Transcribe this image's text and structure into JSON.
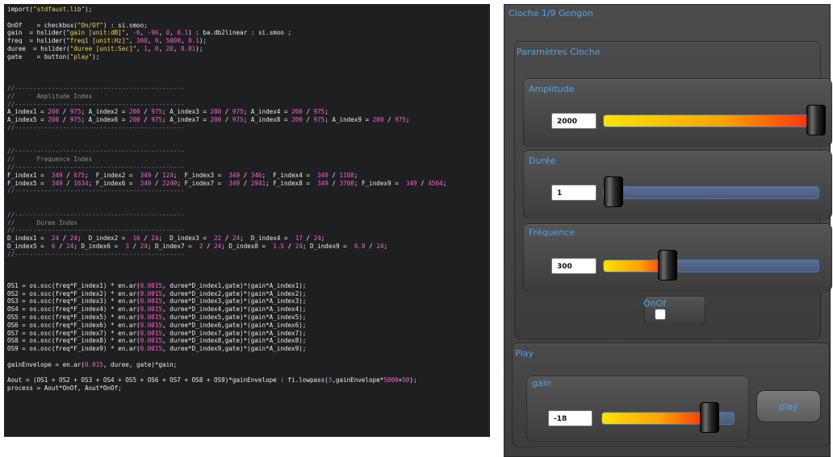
{
  "code": {
    "lines": [
      [
        [
          "import(",
          "txt"
        ],
        [
          "\"stdfaust.lib\"",
          "str"
        ],
        [
          ");",
          "txt"
        ]
      ],
      [],
      [
        [
          "OnOf    = checkbox(",
          "txt"
        ],
        [
          "\"On/Of\"",
          "str"
        ],
        [
          ") : si.smoo;",
          "txt"
        ]
      ],
      [
        [
          "gain  = hslider(",
          "txt"
        ],
        [
          "\"gain [unit:dB]\"",
          "str"
        ],
        [
          ", ",
          "txt"
        ],
        [
          "-6",
          "num"
        ],
        [
          ", ",
          "txt"
        ],
        [
          "-96",
          "num"
        ],
        [
          ", ",
          "txt"
        ],
        [
          "0",
          "num"
        ],
        [
          ", ",
          "txt"
        ],
        [
          "0.1",
          "num"
        ],
        [
          ") : ba.db2linear : si.smoo ;",
          "txt"
        ]
      ],
      [
        [
          "freq  = hslider(",
          "txt"
        ],
        [
          "\"freq1 [unit:Hz]\"",
          "str"
        ],
        [
          ", ",
          "txt"
        ],
        [
          "300",
          "num"
        ],
        [
          ", ",
          "txt"
        ],
        [
          "0",
          "num"
        ],
        [
          ", ",
          "txt"
        ],
        [
          "5000",
          "num"
        ],
        [
          ", ",
          "txt"
        ],
        [
          "0.1",
          "num"
        ],
        [
          ");",
          "txt"
        ]
      ],
      [
        [
          "duree  = hslider(",
          "txt"
        ],
        [
          "\"duree [unit:Sec]\"",
          "str"
        ],
        [
          ", ",
          "txt"
        ],
        [
          "1",
          "num"
        ],
        [
          ", ",
          "txt"
        ],
        [
          "0",
          "num"
        ],
        [
          ", ",
          "txt"
        ],
        [
          "20",
          "num"
        ],
        [
          ", ",
          "txt"
        ],
        [
          "0.01",
          "num"
        ],
        [
          ");",
          "txt"
        ]
      ],
      [
        [
          "gate    = button(",
          "txt"
        ],
        [
          "\"play\"",
          "str"
        ],
        [
          ");",
          "txt"
        ]
      ],
      [],
      [],
      [],
      [
        [
          "//----------------------------------------------",
          "cmt"
        ]
      ],
      [
        [
          "//      Amplitude Index",
          "cmt"
        ]
      ],
      [
        [
          "//----------------------------------------------",
          "cmt"
        ]
      ],
      [
        [
          "A_index1 = ",
          "txt"
        ],
        [
          "200",
          "num"
        ],
        [
          " / ",
          "txt"
        ],
        [
          "975",
          "num"
        ],
        [
          "; A_index2 = ",
          "txt"
        ],
        [
          "200",
          "num"
        ],
        [
          " / ",
          "txt"
        ],
        [
          "975",
          "num"
        ],
        [
          "; A_index3 = ",
          "txt"
        ],
        [
          "200",
          "num"
        ],
        [
          " / ",
          "txt"
        ],
        [
          "975",
          "num"
        ],
        [
          "; A_index4 = ",
          "txt"
        ],
        [
          "200",
          "num"
        ],
        [
          " / ",
          "txt"
        ],
        [
          "975",
          "num"
        ],
        [
          ";",
          "txt"
        ]
      ],
      [
        [
          "A_index5 = ",
          "txt"
        ],
        [
          "200",
          "num"
        ],
        [
          " / ",
          "txt"
        ],
        [
          "975",
          "num"
        ],
        [
          "; A_index6 = ",
          "txt"
        ],
        [
          "200",
          "num"
        ],
        [
          " / ",
          "txt"
        ],
        [
          "975",
          "num"
        ],
        [
          "; A_index7 = ",
          "txt"
        ],
        [
          "200",
          "num"
        ],
        [
          " / ",
          "txt"
        ],
        [
          "975",
          "num"
        ],
        [
          "; A_index8 = ",
          "txt"
        ],
        [
          "200",
          "num"
        ],
        [
          " / ",
          "txt"
        ],
        [
          "975",
          "num"
        ],
        [
          "; A_index9 = ",
          "txt"
        ],
        [
          "200",
          "num"
        ],
        [
          " / ",
          "txt"
        ],
        [
          "975",
          "num"
        ],
        [
          ";",
          "txt"
        ]
      ],
      [
        [
          "//----------------------------------------------",
          "cmt"
        ]
      ],
      [],
      [],
      [
        [
          "//----------------------------------------------",
          "cmt"
        ]
      ],
      [
        [
          "//      Frequence Index",
          "cmt"
        ]
      ],
      [
        [
          "//----------------------------------------------",
          "cmt"
        ]
      ],
      [
        [
          "F_index1 =  ",
          "txt"
        ],
        [
          "349",
          "num"
        ],
        [
          " / ",
          "txt"
        ],
        [
          "675",
          "num"
        ],
        [
          ";  F_index2 =  ",
          "txt"
        ],
        [
          "349",
          "num"
        ],
        [
          " / ",
          "txt"
        ],
        [
          "124",
          "num"
        ],
        [
          ";  F_index3 =  ",
          "txt"
        ],
        [
          "349",
          "num"
        ],
        [
          " / ",
          "txt"
        ],
        [
          "346",
          "num"
        ],
        [
          ";  F_index4 =  ",
          "txt"
        ],
        [
          "349",
          "num"
        ],
        [
          " / ",
          "txt"
        ],
        [
          "1108",
          "num"
        ],
        [
          ";",
          "txt"
        ]
      ],
      [
        [
          "F_index5 =  ",
          "txt"
        ],
        [
          "349",
          "num"
        ],
        [
          " / ",
          "txt"
        ],
        [
          "1634",
          "num"
        ],
        [
          "; F_index6 =  ",
          "txt"
        ],
        [
          "349",
          "num"
        ],
        [
          " / ",
          "txt"
        ],
        [
          "2249",
          "num"
        ],
        [
          "; F_index7 =  ",
          "txt"
        ],
        [
          "349",
          "num"
        ],
        [
          " / ",
          "txt"
        ],
        [
          "2941",
          "num"
        ],
        [
          "; F_index8 =  ",
          "txt"
        ],
        [
          "349",
          "num"
        ],
        [
          " / ",
          "txt"
        ],
        [
          "3700",
          "num"
        ],
        [
          "; F_index9 =  ",
          "txt"
        ],
        [
          "349",
          "num"
        ],
        [
          " / ",
          "txt"
        ],
        [
          "4504",
          "num"
        ],
        [
          ";",
          "txt"
        ]
      ],
      [
        [
          "//----------------------------------------------",
          "cmt"
        ]
      ],
      [],
      [],
      [
        [
          "//----------------------------------------------",
          "cmt"
        ]
      ],
      [
        [
          "//      Duree Index",
          "cmt"
        ]
      ],
      [
        [
          "//----------------------------------------------",
          "cmt"
        ]
      ],
      [
        [
          "D_index1 =  ",
          "txt"
        ],
        [
          "24",
          "num"
        ],
        [
          " / ",
          "txt"
        ],
        [
          "24",
          "num"
        ],
        [
          ";  D_index2 =  ",
          "txt"
        ],
        [
          "16",
          "num"
        ],
        [
          " / ",
          "txt"
        ],
        [
          "24",
          "num"
        ],
        [
          ";  D_index3 =  ",
          "txt"
        ],
        [
          "22",
          "num"
        ],
        [
          " / ",
          "txt"
        ],
        [
          "24",
          "num"
        ],
        [
          ";  D_index4 =  ",
          "txt"
        ],
        [
          "17",
          "num"
        ],
        [
          " / ",
          "txt"
        ],
        [
          "24",
          "num"
        ],
        [
          ";",
          "txt"
        ]
      ],
      [
        [
          "D_index5 =  ",
          "txt"
        ],
        [
          "6",
          "num"
        ],
        [
          " / ",
          "txt"
        ],
        [
          "24",
          "num"
        ],
        [
          "; D_index6 =  ",
          "txt"
        ],
        [
          "3",
          "num"
        ],
        [
          " / ",
          "txt"
        ],
        [
          "24",
          "num"
        ],
        [
          "; D_index7 =  ",
          "txt"
        ],
        [
          "2",
          "num"
        ],
        [
          " / ",
          "txt"
        ],
        [
          "24",
          "num"
        ],
        [
          "; D_index8 =  ",
          "txt"
        ],
        [
          "1.5",
          "num"
        ],
        [
          " / ",
          "txt"
        ],
        [
          "24",
          "num"
        ],
        [
          "; D_index9 =  ",
          "txt"
        ],
        [
          "0.8",
          "num"
        ],
        [
          " / ",
          "txt"
        ],
        [
          "24",
          "num"
        ],
        [
          ";",
          "txt"
        ]
      ],
      [
        [
          "//----------------------------------------------",
          "cmt"
        ]
      ],
      [],
      [],
      [],
      [
        [
          "OS1 = os.osc(freq*F_index1) * en.ar(",
          "txt"
        ],
        [
          "0.0015",
          "num"
        ],
        [
          ", duree*D_index1,gate)*(gain*A_index1);",
          "txt"
        ]
      ],
      [
        [
          "OS2 = os.osc(freq*F_index2) * en.ar(",
          "txt"
        ],
        [
          "0.0015",
          "num"
        ],
        [
          ", duree*D_index2,gate)*(gain*A_index2);",
          "txt"
        ]
      ],
      [
        [
          "OS3 = os.osc(freq*F_index3) * en.ar(",
          "txt"
        ],
        [
          "0.0015",
          "num"
        ],
        [
          ", duree*D_index3,gate)*(gain*A_index3);",
          "txt"
        ]
      ],
      [
        [
          "OS4 = os.osc(freq*F_index4) * en.ar(",
          "txt"
        ],
        [
          "0.0015",
          "num"
        ],
        [
          ", duree*D_index4,gate)*(gain*A_index4);",
          "txt"
        ]
      ],
      [
        [
          "OS5 = os.osc(freq*F_index5) * en.ar(",
          "txt"
        ],
        [
          "0.0015",
          "num"
        ],
        [
          ", duree*D_index5,gate)*(gain*A_index5);",
          "txt"
        ]
      ],
      [
        [
          "OS6 = os.osc(freq*F_index6) * en.ar(",
          "txt"
        ],
        [
          "0.0015",
          "num"
        ],
        [
          ", duree*D_index6,gate)*(gain*A_index6);",
          "txt"
        ]
      ],
      [
        [
          "OS7 = os.osc(freq*F_index7) * en.ar(",
          "txt"
        ],
        [
          "0.0015",
          "num"
        ],
        [
          ", duree*D_index7,gate)*(gain*A_index7);",
          "txt"
        ]
      ],
      [
        [
          "OS8 = os.osc(freq*F_index8) * en.ar(",
          "txt"
        ],
        [
          "0.0015",
          "num"
        ],
        [
          ", duree*D_index8,gate)*(gain*A_index8);",
          "txt"
        ]
      ],
      [
        [
          "OS9 = os.osc(freq*F_index9) * en.ar(",
          "txt"
        ],
        [
          "0.0015",
          "num"
        ],
        [
          ", duree*D_index9,gate)*(gain*A_index9);",
          "txt"
        ]
      ],
      [],
      [
        [
          "gainEnvelope = en.ar(",
          "txt"
        ],
        [
          "0.015",
          "num"
        ],
        [
          ", duree, gate)*gain;",
          "txt"
        ]
      ],
      [],
      [
        [
          "Aout = (OS1 + OS2 + OS3 + OS4 + OS5 + OS6 + OS7 + OS8 + OS9)*gainEnvelope : fi.lowpass(",
          "txt"
        ],
        [
          "3",
          "num"
        ],
        [
          ",gainEnvelope*",
          "txt"
        ],
        [
          "5000",
          "num"
        ],
        [
          "+",
          "txt"
        ],
        [
          "50",
          "num"
        ],
        [
          ");",
          "txt"
        ]
      ],
      [
        [
          "process = Aout*OnOf, Aout*OnOf;",
          "txt"
        ]
      ]
    ]
  },
  "ui": {
    "title": "Cloche 1/9 Gongon",
    "param_group_label": "Paramètres Cloche",
    "amplitude": {
      "label": "Amplitude",
      "value": "2000",
      "fraction": 1.0
    },
    "duree": {
      "label": "Durée",
      "value": "1",
      "fraction": 0.05
    },
    "frequence": {
      "label": "Fréquence",
      "value": "300",
      "fraction": 0.3
    },
    "onof": {
      "label": "OnOf",
      "checked": false
    },
    "play_group_label": "Play",
    "gain": {
      "label": "gain",
      "value": "-18",
      "fraction": 0.81
    },
    "play_button": {
      "label": "play"
    },
    "accent_color": "#4ea4e6"
  }
}
